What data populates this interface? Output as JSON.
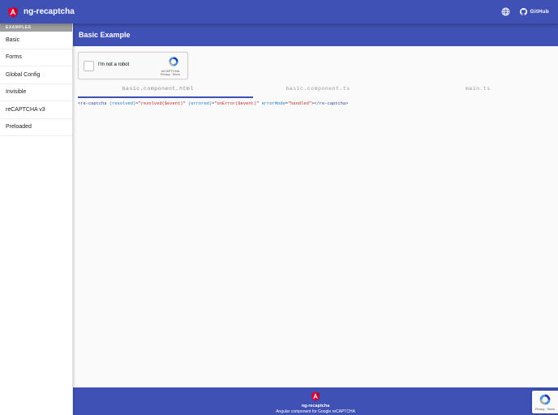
{
  "app": {
    "title": "ng-recaptcha",
    "github_label": "GitHub"
  },
  "sidebar": {
    "header": "EXAMPLES",
    "items": [
      {
        "label": "Basic"
      },
      {
        "label": "Forms"
      },
      {
        "label": "Global Config"
      },
      {
        "label": "Invisible"
      },
      {
        "label": "reCAPTCHA v3"
      },
      {
        "label": "Preloaded"
      }
    ]
  },
  "page": {
    "title": "Basic Example"
  },
  "recaptcha": {
    "label": "I'm not a robot",
    "brand": "reCAPTCHA",
    "terms": "Privacy - Terms"
  },
  "tabs": [
    {
      "label": "basic.component.html",
      "active": true
    },
    {
      "label": "basic.component.ts",
      "active": false
    },
    {
      "label": "main.ts",
      "active": false
    }
  ],
  "code": {
    "open_tag": "<re-captcha",
    "attr1_name": "(resolved)",
    "attr1_value": "\"resolved($event)\"",
    "attr2_name": "(errored)",
    "attr2_value": "\"onError($event)\"",
    "attr3_name": "errorMode",
    "attr3_value": "\"handled\"",
    "close_tag": "></re-captcha>"
  },
  "footer": {
    "title": "ng-recaptcha",
    "subtitle": "Angular component for Google reCAPTCHA"
  },
  "badge": {
    "terms": "Privacy - Terms"
  },
  "icons": {
    "logo": "angular-logo-icon",
    "language": "globe-icon",
    "github": "github-icon",
    "recaptcha": "recaptcha-logo-icon"
  },
  "colors": {
    "primary": "#3f51b5",
    "angular_red": "#dd0031"
  }
}
